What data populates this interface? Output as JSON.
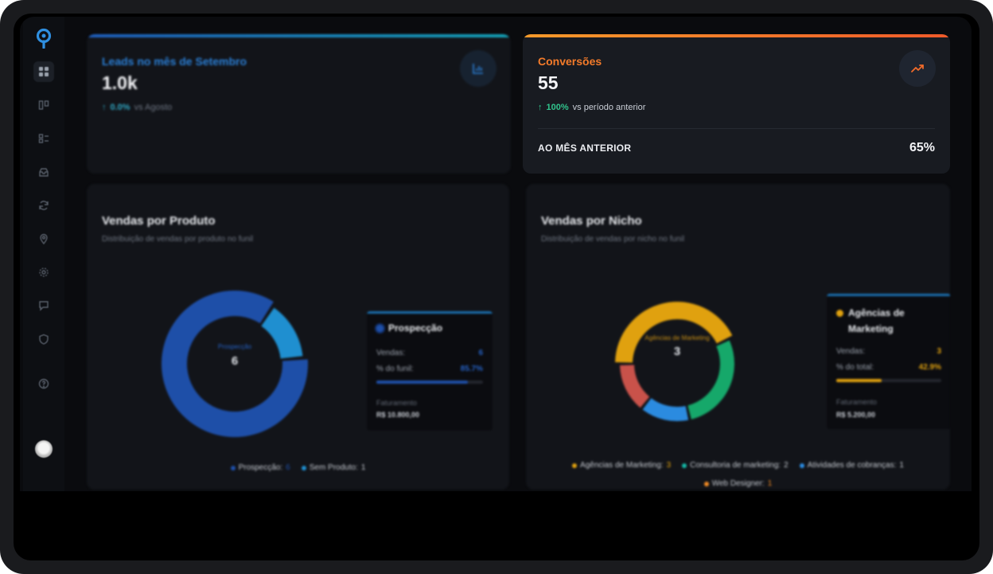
{
  "sidebar": {
    "items": [
      {
        "icon": "dashboard-icon",
        "active": true
      },
      {
        "icon": "kanban-icon"
      },
      {
        "icon": "list-icon"
      },
      {
        "icon": "inbox-icon"
      },
      {
        "icon": "refresh-icon"
      },
      {
        "icon": "location-icon"
      },
      {
        "icon": "settings-icon"
      },
      {
        "icon": "chat-icon"
      },
      {
        "icon": "shield-icon"
      },
      {
        "icon": "help-icon"
      }
    ]
  },
  "kpi_leads": {
    "title": "Leads no mês de Setembro",
    "value": "1.0k",
    "delta_pct": "0.0%",
    "delta_text": "vs Agosto",
    "accent": "#1e88e5"
  },
  "kpi_conversions": {
    "title": "Conversões",
    "value": "55",
    "delta_pct": "100%",
    "delta_text": "vs período anterior",
    "footer_label": "AO MÊS ANTERIOR",
    "footer_value": "65%",
    "accent": "#f26b2a"
  },
  "vendas_produto": {
    "title": "Vendas por Produto",
    "subtitle": "Distribuição de vendas por produto no funil",
    "center_label": "Prospecção",
    "center_value": "6",
    "tooltip": {
      "title": "Prospecção",
      "vendas_label": "Vendas:",
      "vendas_value": "6",
      "funil_label": "% do funil:",
      "funil_value": "85.7%",
      "funil_fraction": 0.857,
      "fat_label": "Faturamento",
      "fat_value": "R$ 10.800,00",
      "color": "#1e4fa8"
    },
    "legend": [
      {
        "label": "Prospecção:",
        "count": "6",
        "color": "#1e4fa8"
      },
      {
        "label": "Sem Produto:",
        "count": "1",
        "color": "#1f8fd0"
      }
    ]
  },
  "vendas_nicho": {
    "title": "Vendas por Nicho",
    "subtitle": "Distribuição de vendas por nicho no funil",
    "center_label": "Agências de Marketing",
    "center_value": "3",
    "tooltip": {
      "title": "Agências de Marketing",
      "vendas_label": "Vendas:",
      "vendas_value": "3",
      "total_label": "% do total:",
      "total_value": "42.9%",
      "total_fraction": 0.429,
      "fat_label": "Faturamento",
      "fat_value": "R$ 5.200,00",
      "color": "#e0a10f"
    },
    "legend_row1": [
      {
        "label": "Agências de Marketing:",
        "count": "3",
        "color": "#e0a10f"
      },
      {
        "label": "Consultoria de marketing:",
        "count": "2",
        "color": "#14b8a6"
      },
      {
        "label": "Atividades de cobranças:",
        "count": "1",
        "color": "#2b8be0"
      }
    ],
    "legend_row2": [
      {
        "label": "Web Designer:",
        "count": "1",
        "color": "#f08a24"
      }
    ]
  },
  "chart_data": [
    {
      "type": "pie",
      "title": "Vendas por Produto",
      "categories": [
        "Prospecção",
        "Sem Produto"
      ],
      "values": [
        6,
        1
      ],
      "colors": [
        "#1e4fa8",
        "#1f8fd0"
      ]
    },
    {
      "type": "pie",
      "title": "Vendas por Nicho",
      "categories": [
        "Agências de Marketing",
        "Consultoria de marketing",
        "Atividades de cobranças",
        "Web Designer"
      ],
      "values": [
        3,
        2,
        1,
        1
      ],
      "colors": [
        "#e0a10f",
        "#16a86a",
        "#2b8be0",
        "#c9524a"
      ]
    }
  ]
}
